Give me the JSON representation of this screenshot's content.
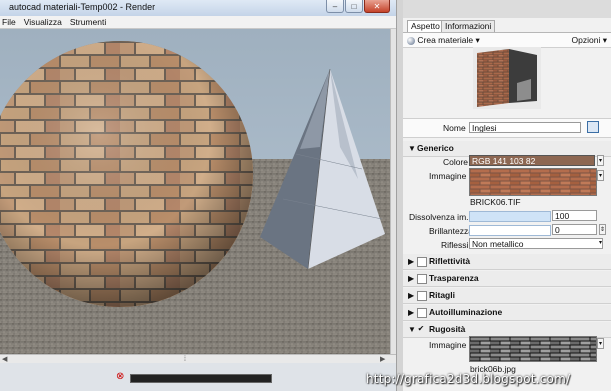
{
  "render_window": {
    "title": "autocad materiali-Temp002 - Render",
    "menu": [
      "File",
      "Visualizza",
      "Strumenti"
    ],
    "controls": {
      "minimize": "–",
      "maximize": "□",
      "close": "✕"
    }
  },
  "properties": {
    "tabs": [
      {
        "label": "Aspetto",
        "active": true
      },
      {
        "label": "Informazioni",
        "active": false
      }
    ],
    "toolbar": {
      "create_material": "Crea materiale",
      "options": "Opzioni"
    },
    "name_label": "Nome",
    "name_value": "Inglesi",
    "generic": {
      "title": "Generico",
      "color_label": "Colore",
      "color_value": "RGB 141 103 82",
      "color_hex": "#8d6752",
      "image_label": "Immagine",
      "image_file": "BRICK06.TIF",
      "fade_label": "Dissolvenza im...",
      "fade_value": "100",
      "gloss_label": "Brillantezza",
      "gloss_value": "0",
      "highlights_label": "Riflessi",
      "highlights_value": "Non metallico"
    },
    "sections": [
      {
        "title": "Riflettività",
        "checked": false,
        "expanded": false
      },
      {
        "title": "Trasparenza",
        "checked": false,
        "expanded": false
      },
      {
        "title": "Ritagli",
        "checked": false,
        "expanded": false
      },
      {
        "title": "Autoilluminazione",
        "checked": false,
        "expanded": false
      },
      {
        "title": "Rugosità",
        "checked": true,
        "expanded": true
      }
    ],
    "bump": {
      "image_label": "Immagine",
      "image_file": "brick06b.jpg"
    }
  },
  "watermark": "http://grafica2d3d.blogspot.com/",
  "icons": {
    "create": "sphere-icon",
    "options": "gear-icon",
    "name_btn": "map-icon"
  }
}
